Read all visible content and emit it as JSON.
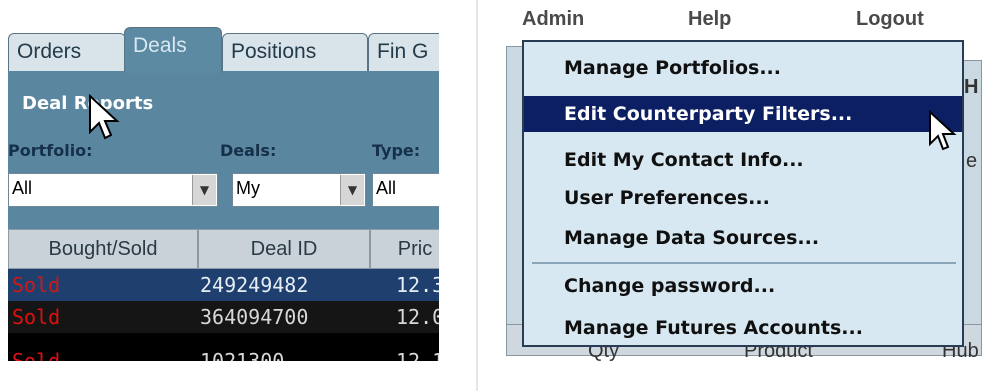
{
  "left_panel": {
    "tabs": [
      "Orders",
      "Deals",
      "Positions",
      "Fin G"
    ],
    "active_tab": "Deals",
    "section_title": "Deal Reports",
    "filters": [
      {
        "label": "Portfolio:",
        "value": "All"
      },
      {
        "label": "Deals:",
        "value": "My"
      },
      {
        "label": "Type:",
        "value": "All"
      }
    ],
    "table": {
      "columns": [
        "Bought/Sold",
        "Deal ID",
        "Pric"
      ],
      "rows": [
        {
          "side": "Sold",
          "deal_id": "249249482",
          "price": "12.3"
        },
        {
          "side": "Sold",
          "deal_id": "364094700",
          "price": "12.0"
        },
        {
          "side": "Sold",
          "deal_id": "1021300",
          "price": "12.1"
        }
      ]
    }
  },
  "right_panel": {
    "menubar": [
      "Admin",
      "Help",
      "Logout"
    ],
    "admin_menu": [
      {
        "label": "Manage Portfolios...",
        "highlighted": false
      },
      {
        "label": "Edit Counterparty Filters...",
        "highlighted": true
      },
      {
        "label": "Edit My Contact Info...",
        "highlighted": false
      },
      {
        "label": "User Preferences...",
        "highlighted": false
      },
      {
        "label": "Manage Data Sources...",
        "highlighted": false
      },
      {
        "label": "Change password...",
        "highlighted": false
      },
      {
        "label": "Manage Futures Accounts...",
        "highlighted": false
      }
    ],
    "background_fragments": {
      "right_edge_1": "H",
      "right_edge_2": "e",
      "bottom_1": "Qty",
      "bottom_2": "Product",
      "bottom_3": "Hub"
    }
  },
  "colors": {
    "tab_active": "#5d8aa3",
    "panel_blue": "#5a86a0",
    "menu_bg": "#d7e8f2",
    "menu_highlight": "#0d1f63",
    "sold_red": "#e01010",
    "selected_row": "#1f3f6e"
  },
  "icons": [
    "mouse-cursor-icon",
    "dropdown-arrow-icon"
  ]
}
